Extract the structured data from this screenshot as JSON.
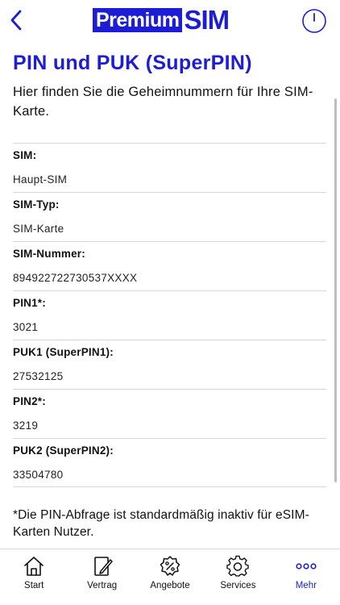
{
  "header": {
    "logo_word1": "Premium",
    "logo_word2": "SIM"
  },
  "page": {
    "title": "PIN und PUK (SuperPIN)",
    "intro": "Hier finden Sie die Geheimnummern für Ihre SIM-Karte."
  },
  "rows": [
    {
      "label": "SIM:",
      "value": "Haupt-SIM"
    },
    {
      "label": "SIM-Typ:",
      "value": "SIM-Karte"
    },
    {
      "label": "SIM-Nummer:",
      "value": "894922722730537XXXX"
    },
    {
      "label": "PIN1*:",
      "value": "3021"
    },
    {
      "label": "PUK1 (SuperPIN1):",
      "value": "27532125"
    },
    {
      "label": "PIN2*:",
      "value": "3219"
    },
    {
      "label": "PUK2 (SuperPIN2):",
      "value": "33504780"
    }
  ],
  "footnote": "*Die PIN-Abfrage ist standardmäßig inaktiv für eSIM-Karten Nutzer.",
  "tabbar": {
    "tabs": [
      {
        "label": "Start",
        "icon": "home-icon"
      },
      {
        "label": "Vertrag",
        "icon": "contract-icon"
      },
      {
        "label": "Angebote",
        "icon": "offers-icon"
      },
      {
        "label": "Services",
        "icon": "gear-icon"
      },
      {
        "label": "Mehr",
        "icon": "more-icon"
      }
    ],
    "active_tab": "Mehr"
  },
  "colors": {
    "accent": "#1d1dd6",
    "divider": "#d7d7d7"
  }
}
